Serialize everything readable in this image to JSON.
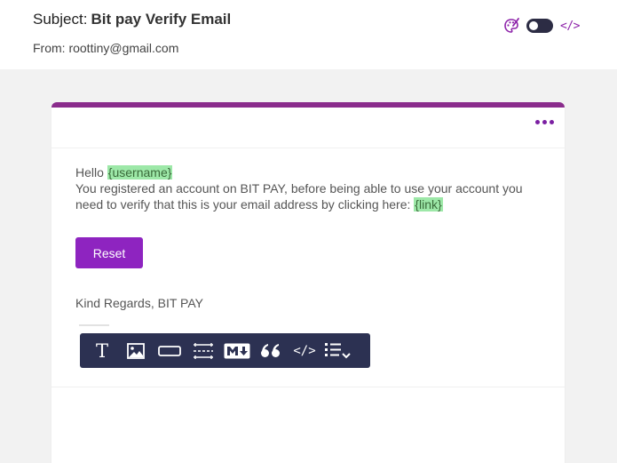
{
  "header": {
    "subject_label": "Subject:",
    "subject_value": "Bit pay Verify Email",
    "from_text": "From: roottiny@gmail.com",
    "tools": {
      "theme_icon": "palette-icon",
      "toggle_icon": "toggle-switch-icon",
      "code_label": "</>"
    }
  },
  "colors": {
    "accent": "#8a2c8c",
    "button": "#8e24c0",
    "toolbar": "#2c3152",
    "tag_bg": "#9de8a8"
  },
  "email": {
    "greeting": "Hello ",
    "username_tag": "{username}",
    "body_line": "You registered an account on BIT PAY, before being able to use your account you need to verify that this is your email address by clicking here: ",
    "link_tag": "{link}",
    "button_label": "Reset",
    "closing": "Kind Regards, BIT PAY"
  },
  "card": {
    "menu_icon": "more-horizontal-icon"
  },
  "toolbar": {
    "text_label": "T",
    "quote_label": "“",
    "code_label": "</>",
    "items": [
      "text-icon",
      "image-icon",
      "button-block-icon",
      "divider-icon",
      "markdown-icon",
      "quote-icon",
      "code-icon",
      "list-dropdown-icon"
    ]
  }
}
